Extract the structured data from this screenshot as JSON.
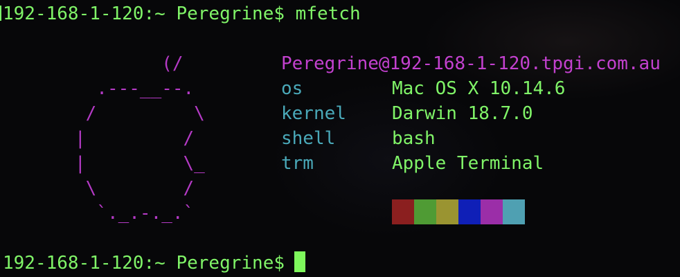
{
  "prompt": {
    "host": "192-168-1-120",
    "path": "~",
    "user": "Peregrine",
    "symbol": "$",
    "command": "mfetch"
  },
  "ascii_logo": [
    "        (/",
    "  .---__--.",
    " /         \\",
    "|         /",
    "|         \\_",
    " \\        /",
    "  `._.-._.`"
  ],
  "info": {
    "user_host": "Peregrine@192-168-1-120.tpgi.com.au",
    "rows": [
      {
        "key": "os",
        "value": "Mac OS X 10.14.6"
      },
      {
        "key": "kernel",
        "value": "Darwin 18.7.0"
      },
      {
        "key": "shell",
        "value": "bash"
      },
      {
        "key": "trm",
        "value": "Apple Terminal"
      }
    ]
  },
  "palette": [
    "#8b1f1f",
    "#4f9b34",
    "#9a9431",
    "#0f1fb7",
    "#9b2ea8",
    "#4fa0b2"
  ]
}
